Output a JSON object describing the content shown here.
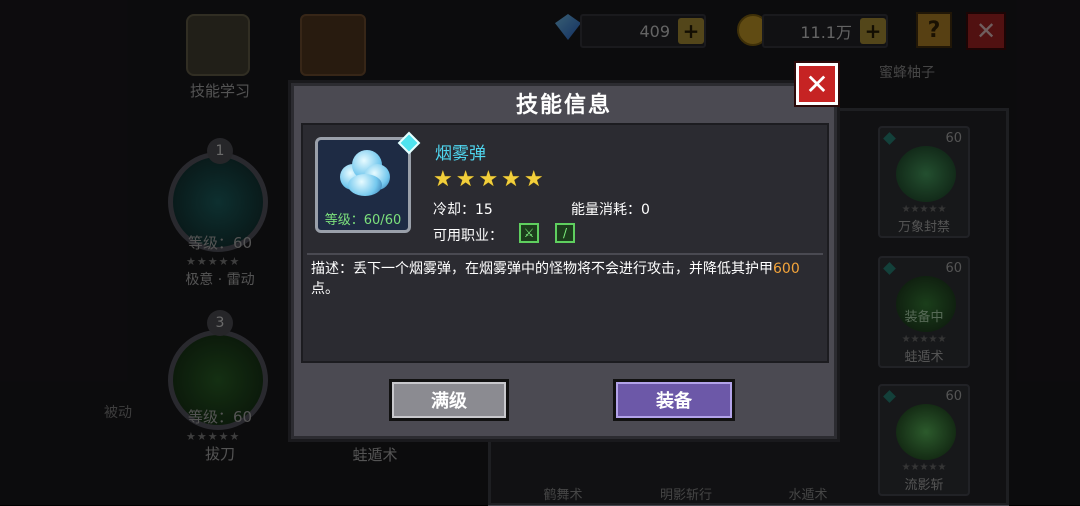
{
  "currency": {
    "gems": "409",
    "gold": "11.1万"
  },
  "top_icons": {
    "help": "?",
    "close": "✕"
  },
  "background": {
    "menu_label": "技能学习",
    "pet_name": "蜜蜂柚子",
    "slots": [
      {
        "num": "1",
        "level": "等级：60",
        "stars": "★★★★★",
        "name": "极意 · 雷动"
      },
      {
        "num": "3",
        "level": "等级：60",
        "stars": "★★★★★",
        "name": "拔刀"
      }
    ],
    "passive_label": "被动",
    "bottom_name": "蛙遁术",
    "grid": [
      {
        "lv": "60",
        "stars": "★★★★★",
        "name": "万象封禁",
        "tag": ""
      },
      {
        "lv": "60",
        "stars": "★★★★★",
        "name": "蛙遁术",
        "tag": "装备中"
      },
      {
        "lv": "60",
        "stars": "★★★★★",
        "name": "流影斩",
        "tag": ""
      }
    ],
    "grid_bottom_names": [
      "鹤舞术",
      "明影斩行",
      "水遁术"
    ]
  },
  "modal": {
    "title": "技能信息",
    "close": "✕",
    "skill_name": "烟雾弹",
    "level": "等级：60/60",
    "stars": "★★★★★",
    "cooldown": "冷却：15",
    "energy": "能量消耗：0",
    "jobs_label": "可用职业：",
    "desc_prefix": "描述：丢下一个烟雾弹，在烟雾弹中的怪物将不会进行攻击，并降低其护甲",
    "desc_value": "600",
    "desc_suffix": "点。",
    "btn_max": "满级",
    "btn_equip": "装备"
  }
}
